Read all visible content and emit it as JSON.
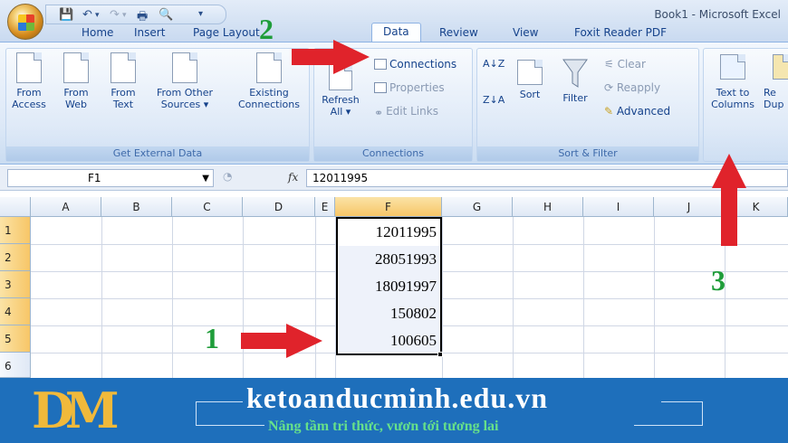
{
  "window": {
    "title": "Book1 - Microsoft Excel"
  },
  "qat": {
    "icons": [
      "save-icon",
      "undo-icon",
      "redo-icon",
      "print-icon",
      "print-preview-icon",
      "customize-icon"
    ]
  },
  "tabs": [
    {
      "label": "Home"
    },
    {
      "label": "Insert"
    },
    {
      "label": "Page Layout"
    },
    {
      "label": "Data",
      "active": true
    },
    {
      "label": "Review"
    },
    {
      "label": "View"
    },
    {
      "label": "Foxit Reader PDF"
    }
  ],
  "ribbon": {
    "get_external": {
      "label": "Get External Data",
      "from_access": {
        "l1": "From",
        "l2": "Access"
      },
      "from_web": {
        "l1": "From",
        "l2": "Web"
      },
      "from_text": {
        "l1": "From",
        "l2": "Text"
      },
      "from_other": {
        "l1": "From Other",
        "l2": "Sources ▾"
      },
      "existing": {
        "l1": "Existing",
        "l2": "Connections"
      }
    },
    "connections": {
      "label": "Connections",
      "refresh": {
        "l1": "Refresh",
        "l2": "All ▾"
      },
      "connections": "Connections",
      "properties": "Properties",
      "edit_links": "Edit Links"
    },
    "sort_filter": {
      "label": "Sort & Filter",
      "sort_az": "A↓Z",
      "sort_za": "Z↓A",
      "sort": "Sort",
      "filter": "Filter",
      "clear": "Clear",
      "reapply": "Reapply",
      "advanced": "Advanced"
    },
    "data_tools": {
      "text_to_columns": {
        "l1": "Text to",
        "l2": "Columns"
      },
      "remove_dup": {
        "l1": "Re",
        "l2": "Dup"
      }
    }
  },
  "formula_bar": {
    "name_box": "F1",
    "fx": "fx",
    "value": "12011995"
  },
  "grid": {
    "columns": [
      "A",
      "B",
      "C",
      "D",
      "E",
      "F",
      "G",
      "H",
      "I",
      "J",
      "K"
    ],
    "rows": [
      "1",
      "2",
      "3",
      "4",
      "5",
      "6"
    ],
    "f_values": [
      "12011995",
      "28051993",
      "18091997",
      "150802",
      "100605"
    ]
  },
  "annotations": {
    "one": "1",
    "two": "2",
    "three": "3"
  },
  "banner": {
    "site": "ketoanducminh.edu.vn",
    "slogan": "Nâng tầm tri thức, vươn tới tương lai",
    "accent": "#f0b93b"
  }
}
